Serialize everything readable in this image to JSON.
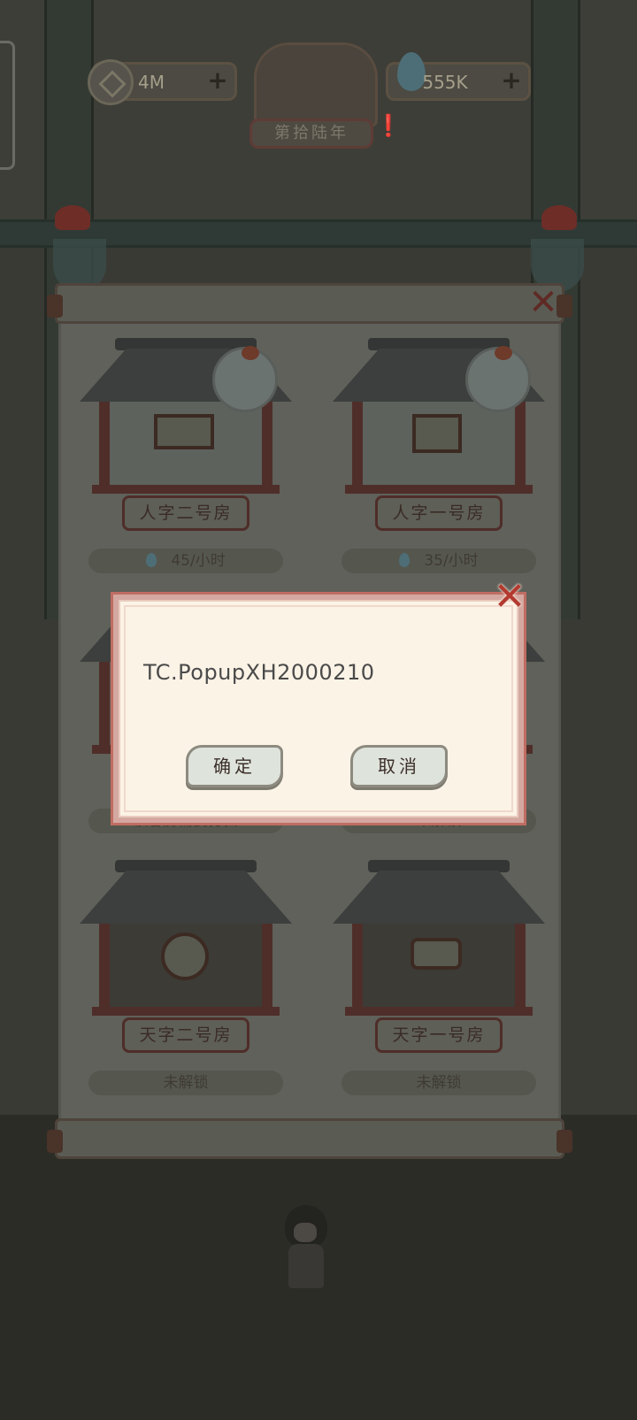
{
  "resources": {
    "coins": "4M",
    "water": "555K",
    "plus": "+"
  },
  "year_label": "第拾陆年",
  "panel": {
    "close_label": "✕",
    "rooms": [
      {
        "name": "人字二号房",
        "status": "45/小时",
        "locked": false
      },
      {
        "name": "人字一号房",
        "status": "35/小时",
        "locked": false
      },
      {
        "name": "",
        "status": "该客房需要打扫",
        "locked": false
      },
      {
        "name": "",
        "status": "未解锁",
        "locked": true
      },
      {
        "name": "天字二号房",
        "status": "未解锁",
        "locked": true
      },
      {
        "name": "天字一号房",
        "status": "未解锁",
        "locked": true
      }
    ]
  },
  "dialog": {
    "message": "TC.PopupXH2000210",
    "confirm_label": "确定",
    "cancel_label": "取消",
    "close_label": "✕"
  },
  "colors": {
    "dialog_bg": "#fbf3e6",
    "dialog_border": "#c06d63",
    "close_red": "#b33a30"
  }
}
